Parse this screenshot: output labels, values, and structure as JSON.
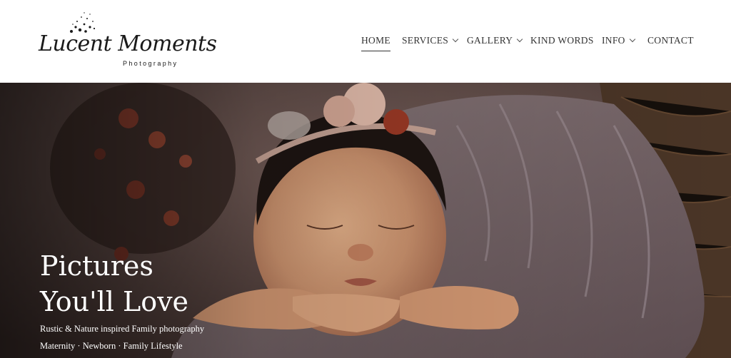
{
  "brand": {
    "name": "Lucent Moments",
    "tagline": "Photography"
  },
  "nav": {
    "items": [
      {
        "label": "HOME",
        "active": true,
        "dropdown": false
      },
      {
        "label": "SERVICES",
        "active": false,
        "dropdown": true
      },
      {
        "label": "GALLERY",
        "active": false,
        "dropdown": true
      },
      {
        "label": "KIND WORDS",
        "active": false,
        "dropdown": false
      },
      {
        "label": "INFO",
        "active": false,
        "dropdown": true
      },
      {
        "label": "CONTACT",
        "active": false,
        "dropdown": false
      }
    ]
  },
  "hero": {
    "title_line1": "Pictures",
    "title_line2": "You'll Love",
    "subtitle": "Rustic & Nature inspired Family photography",
    "services": "Maternity · Newborn · Family Lifestyle"
  },
  "colors": {
    "nav_text": "#333333",
    "hero_text": "#ffffff",
    "wrap": "#7d6a6e"
  }
}
